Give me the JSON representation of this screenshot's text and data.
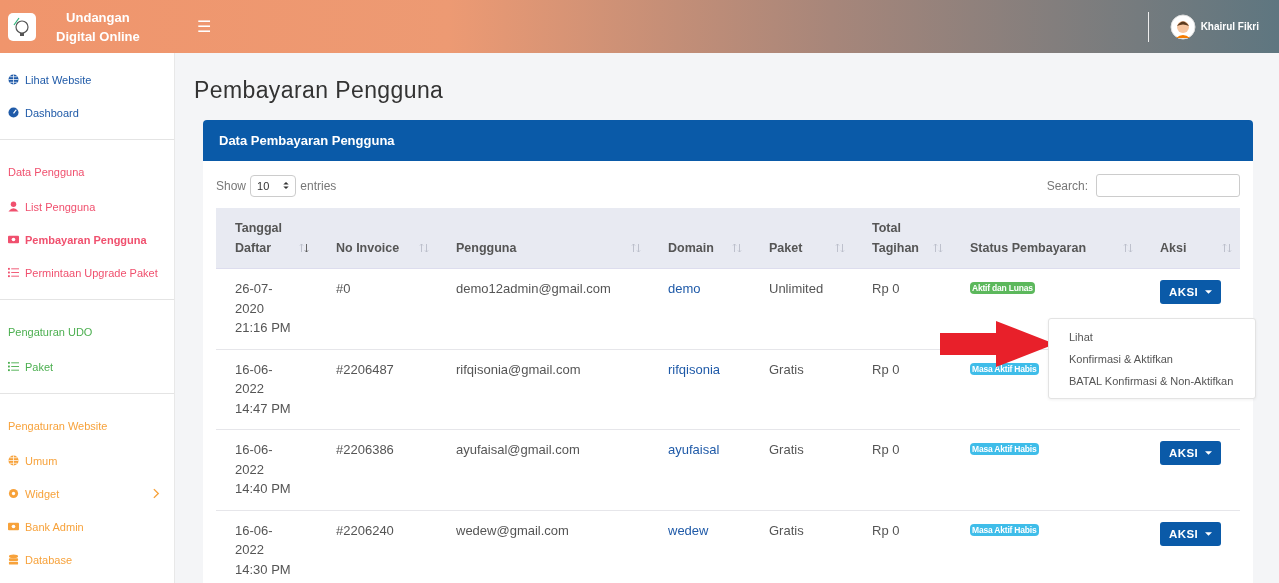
{
  "header": {
    "brand": [
      "Undangan",
      "Digital Online"
    ],
    "menu_icon": "☰",
    "user": "Khairul Fikri"
  },
  "sidebar": {
    "sections": [
      {
        "color": "#1f5aa8",
        "items": [
          {
            "label": "Lihat Website",
            "selected": false,
            "expandable": false
          },
          {
            "label": "Dashboard",
            "selected": false,
            "expandable": false
          }
        ]
      },
      {
        "title": "Data Pengguna",
        "color": "#f0506e",
        "items": [
          {
            "label": "List Pengguna",
            "selected": false,
            "expandable": false
          },
          {
            "label": "Pembayaran Pengguna",
            "selected": true,
            "expandable": false
          },
          {
            "label": "Permintaan Upgrade Paket",
            "selected": false,
            "expandable": false
          }
        ]
      },
      {
        "title": "Pengaturan UDO",
        "color": "#4caf50",
        "items": [
          {
            "label": "Paket",
            "selected": false,
            "expandable": false
          }
        ]
      },
      {
        "title": "Pengaturan Website",
        "color": "#f7a23b",
        "items": [
          {
            "label": "Umum",
            "selected": false,
            "expandable": false
          },
          {
            "label": "Widget",
            "selected": false,
            "expandable": true
          },
          {
            "label": "Bank Admin",
            "selected": false,
            "expandable": false
          },
          {
            "label": "Database",
            "selected": false,
            "expandable": false
          }
        ]
      }
    ]
  },
  "page_title": "Pembayaran Pengguna",
  "card": {
    "title": "Data Pembayaran Pengguna",
    "length": {
      "label_before": "Show",
      "value": "10",
      "label_after": "entries"
    },
    "search": {
      "label": "Search:"
    },
    "table": {
      "columns": [
        {
          "label": "Tanggal Daftar",
          "sorted": true
        },
        {
          "label": "No Invoice",
          "sorted": false
        },
        {
          "label": "Pengguna",
          "sorted": false
        },
        {
          "label": "Domain",
          "sorted": false
        },
        {
          "label": "Paket",
          "sorted": false
        },
        {
          "label": "Total Tagihan",
          "sorted": false
        },
        {
          "label": "Status Pembayaran",
          "sorted": false
        },
        {
          "label": "Aksi",
          "sorted": false
        }
      ],
      "rows": [
        {
          "date": "26-07-2020 21:16 PM",
          "invoice": "#0",
          "user": "demo12admin@gmail.com",
          "domain": "demo",
          "package": "Unlimited",
          "total": "Rp 0",
          "status": {
            "label": "Aktif dan Lunas",
            "kind": "active"
          },
          "action": "AKSI",
          "menu": [
            "Lihat",
            "Konfirmasi & Aktifkan",
            "BATAL Konfirmasi & Non-Aktifkan"
          ]
        },
        {
          "date": "16-06-2022 14:47 PM",
          "invoice": "#2206487",
          "user": "rifqisonia@gmail.com",
          "domain": "rifqisonia",
          "package": "Gratis",
          "total": "Rp 0",
          "status": {
            "label": "Masa Aktif Habis",
            "kind": "expired"
          }
        },
        {
          "date": "16-06-2022 14:40 PM",
          "invoice": "#2206386",
          "user": "ayufaisal@gmail.com",
          "domain": "ayufaisal",
          "package": "Gratis",
          "total": "Rp 0",
          "status": {
            "label": "Masa Aktif Habis",
            "kind": "expired"
          },
          "action": "AKSI"
        },
        {
          "date": "16-06-2022 14:30 PM",
          "invoice": "#2206240",
          "user": "wedew@gmail.com",
          "domain": "wedew",
          "package": "Gratis",
          "total": "Rp 0",
          "status": {
            "label": "Masa Aktif Habis",
            "kind": "expired"
          },
          "action": "AKSI"
        }
      ]
    }
  }
}
